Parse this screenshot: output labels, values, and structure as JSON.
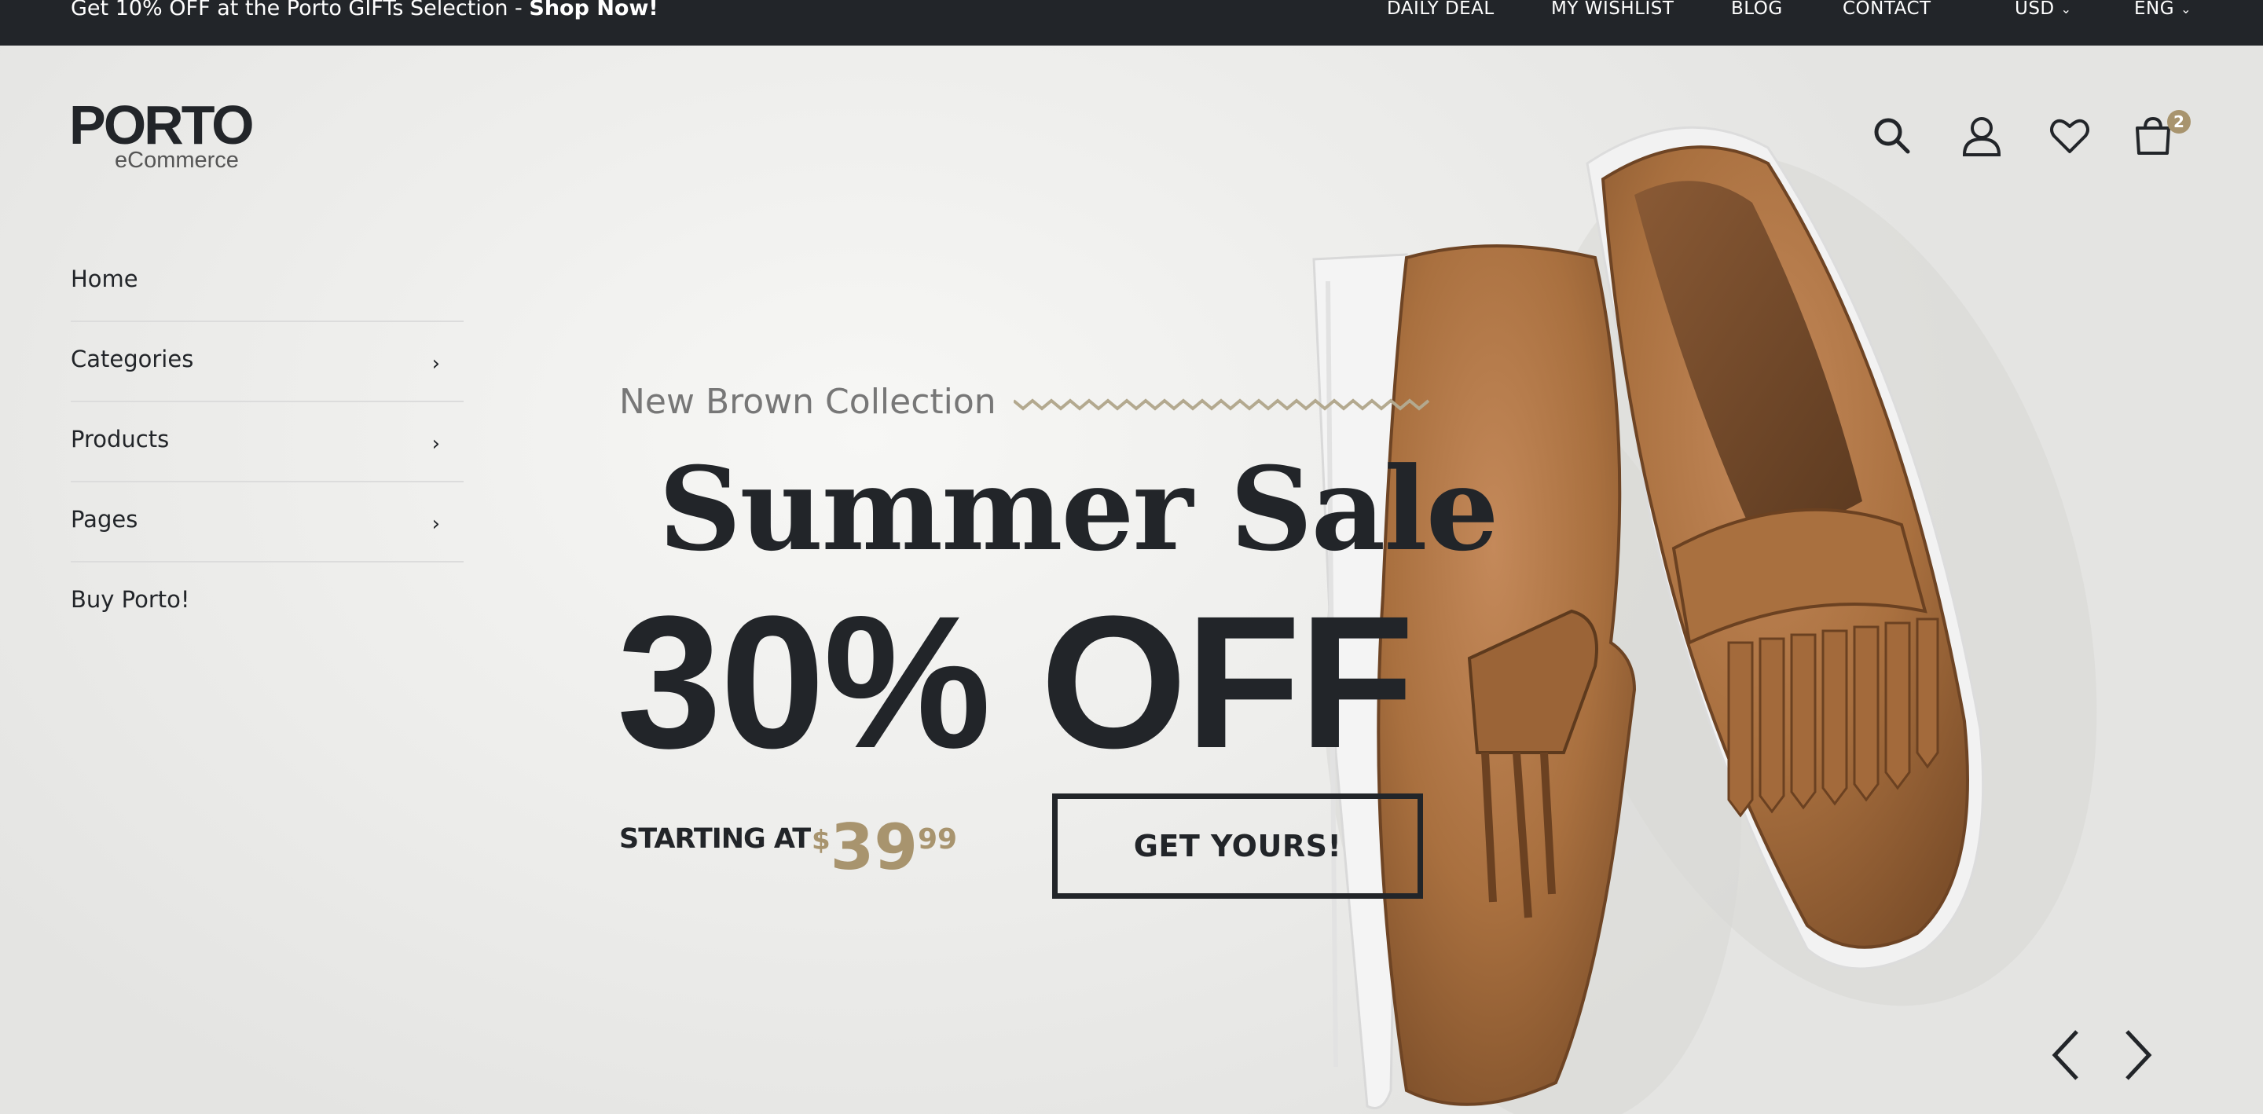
{
  "topbar": {
    "promo_text": "Get 10% OFF at the Porto GIFTs Selection - ",
    "promo_link": "Shop Now!",
    "nav": [
      "DAILY DEAL",
      "MY WISHLIST",
      "BLOG",
      "CONTACT"
    ],
    "currency": "USD",
    "language": "ENG"
  },
  "logo": {
    "main": "PORTO",
    "sub": "eCommerce"
  },
  "menu": {
    "items": [
      {
        "label": "Home",
        "has_submenu": false
      },
      {
        "label": "Categories",
        "has_submenu": true
      },
      {
        "label": "Products",
        "has_submenu": true
      },
      {
        "label": "Pages",
        "has_submenu": true
      },
      {
        "label": "Buy Porto!",
        "has_submenu": false
      }
    ]
  },
  "header_icons": [
    "search-icon",
    "user-icon",
    "heart-icon",
    "cart-icon"
  ],
  "cart": {
    "count": "2"
  },
  "slide": {
    "subtitle": "New Brown Collection",
    "title": "Summer Sale",
    "headline": "30% OFF",
    "starting_label": "STARTING AT",
    "price_currency": "$",
    "price_int": "39",
    "price_cents": "99",
    "cta": "GET YOURS!"
  },
  "colors": {
    "dark": "#222529",
    "accent": "#a8946e",
    "shoe": "#a9703f"
  }
}
